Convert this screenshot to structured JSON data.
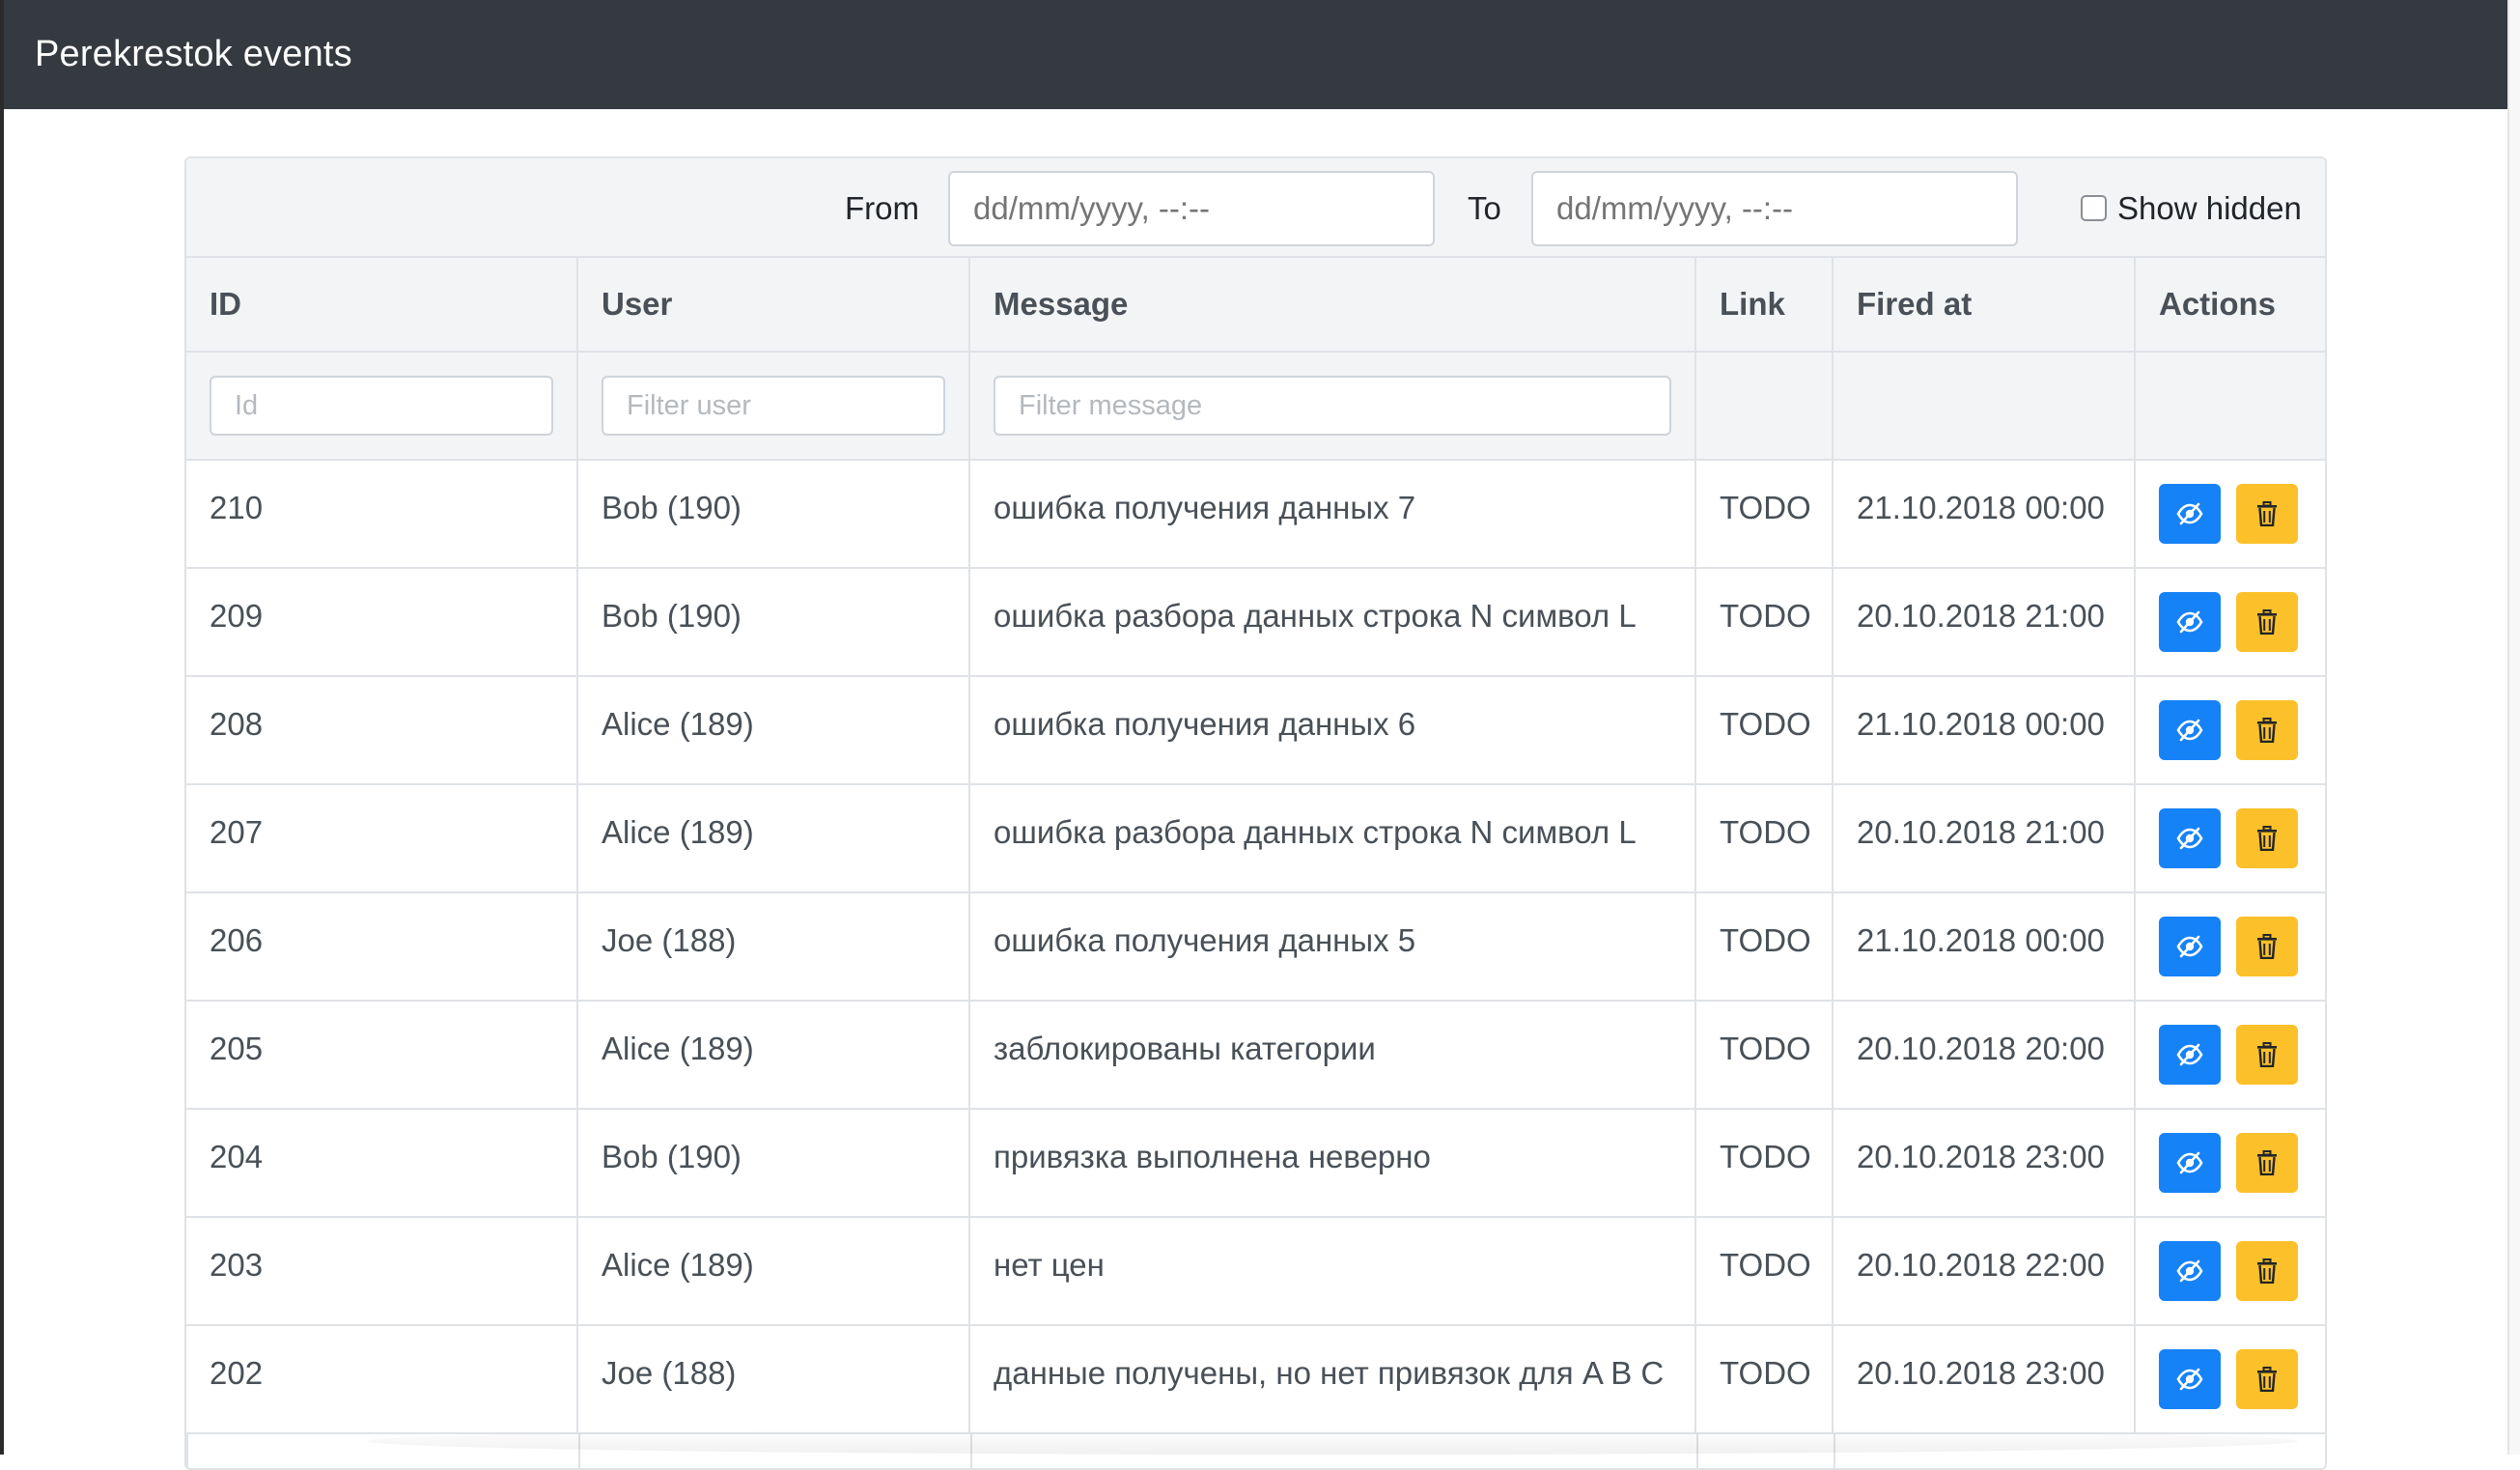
{
  "app": {
    "title": "Perekrestok events"
  },
  "filters": {
    "from_label": "From",
    "from_placeholder": "dd/mm/yyyy, --:--",
    "to_label": "To",
    "to_placeholder": "dd/mm/yyyy, --:--",
    "show_hidden_label": "Show hidden",
    "show_hidden_checked": false
  },
  "table": {
    "columns": {
      "id": "ID",
      "user": "User",
      "message": "Message",
      "link": "Link",
      "fired_at": "Fired at",
      "actions": "Actions"
    },
    "filters": {
      "id_placeholder": "Id",
      "user_placeholder": "Filter user",
      "message_placeholder": "Filter message"
    },
    "rows": [
      {
        "id": "210",
        "user": "Bob (190)",
        "message": "ошибка получения данных 7",
        "link": "TODO",
        "fired_at": "21.10.2018 00:00"
      },
      {
        "id": "209",
        "user": "Bob (190)",
        "message": "ошибка разбора данных строка N символ L",
        "link": "TODO",
        "fired_at": "20.10.2018 21:00"
      },
      {
        "id": "208",
        "user": "Alice (189)",
        "message": "ошибка получения данных 6",
        "link": "TODO",
        "fired_at": "21.10.2018 00:00"
      },
      {
        "id": "207",
        "user": "Alice (189)",
        "message": "ошибка разбора данных строка N символ L",
        "link": "TODO",
        "fired_at": "20.10.2018 21:00"
      },
      {
        "id": "206",
        "user": "Joe (188)",
        "message": "ошибка получения данных 5",
        "link": "TODO",
        "fired_at": "21.10.2018 00:00"
      },
      {
        "id": "205",
        "user": "Alice (189)",
        "message": "заблокированы категории",
        "link": "TODO",
        "fired_at": "20.10.2018 20:00"
      },
      {
        "id": "204",
        "user": "Bob (190)",
        "message": "привязка выполнена неверно",
        "link": "TODO",
        "fired_at": "20.10.2018 23:00"
      },
      {
        "id": "203",
        "user": "Alice (189)",
        "message": "нет цен",
        "link": "TODO",
        "fired_at": "20.10.2018 22:00"
      },
      {
        "id": "202",
        "user": "Joe (188)",
        "message": "данные получены, но нет привязок для A B C",
        "link": "TODO",
        "fired_at": "20.10.2018 23:00"
      }
    ],
    "row_actions": {
      "view_icon": "eye-icon",
      "delete_icon": "trash-icon"
    }
  },
  "colors": {
    "navbar": "#343a40",
    "primary": "#1682f8",
    "warning": "#fcc02a",
    "header_bg": "#f3f4f6",
    "border": "#dfe2e6"
  }
}
